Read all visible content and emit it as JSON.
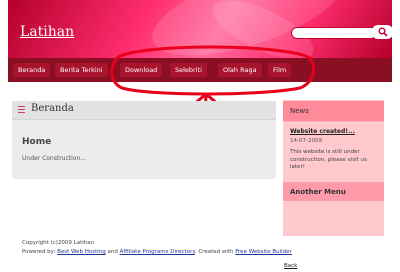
{
  "header": {
    "site_title": "Latihan",
    "search": {
      "value": ""
    }
  },
  "nav": {
    "items": [
      {
        "label": "Beranda"
      },
      {
        "label": "Berita Terkini"
      },
      {
        "label": "Download"
      },
      {
        "label": "Selebriti"
      },
      {
        "label": "Olah Raga"
      },
      {
        "label": "Film"
      }
    ]
  },
  "main": {
    "section_title": "Beranda",
    "article_title": "Home",
    "article_body": "Under Construction..."
  },
  "sidebar": {
    "news_title": "News",
    "news_link": "Website created!...",
    "news_date": "14-07-2009",
    "news_body": "This website is still under construction, please visit us later!",
    "another_menu_title": "Another Menu"
  },
  "footer": {
    "copyright": "Copyright (c)2009 Latihan",
    "powered_by": "Powered by:",
    "link_hosting": "Best Web Hosting",
    "and_text": "and",
    "link_directory": "Affiliate Programs Directory",
    "created_with": ". Created with",
    "link_builder": "Free Website Builder",
    "back": "Back"
  },
  "colors": {
    "header_red": "#e0103f",
    "nav_dark": "#8a0f22",
    "annotation_red": "#e8001c",
    "sidebar_pink": "#ffc9cd"
  },
  "icons": {
    "search": "magnifier-icon",
    "section_menu": "menu-lines-icon"
  }
}
